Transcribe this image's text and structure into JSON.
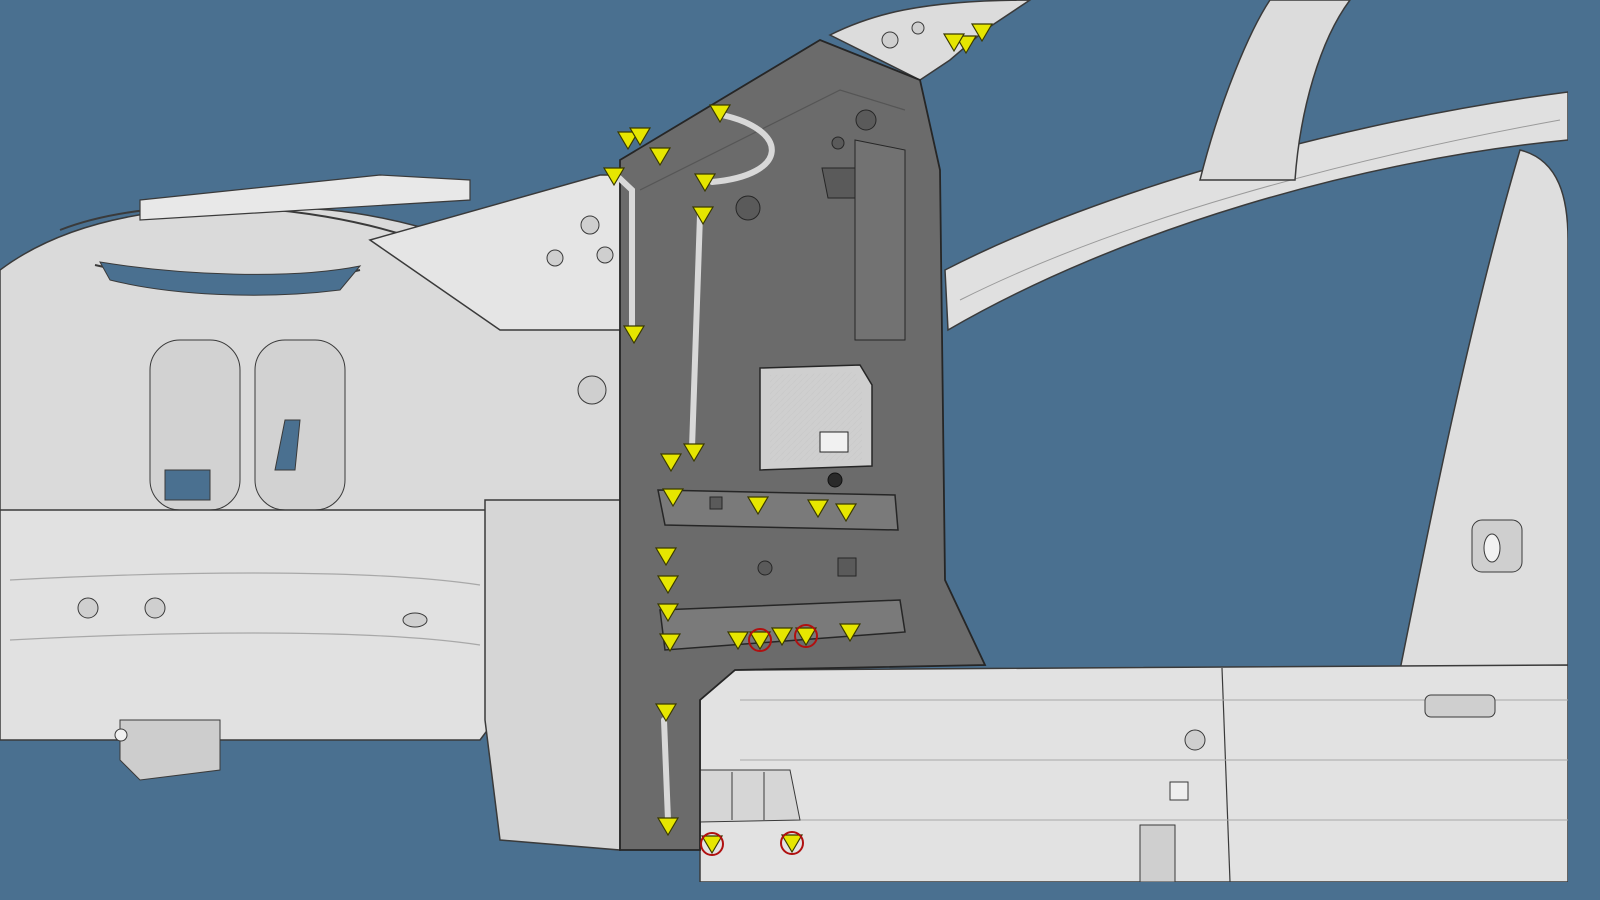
{
  "viewport": {
    "background": "#4a7090",
    "panel_light": "#e3e3e3",
    "panel_mid": "#cfcfcf",
    "panel_shadow": "#b8b8b8",
    "highlight_panel": "#6b6b6b",
    "highlight_panel_light": "#7d7d7d",
    "outline": "#3a3a3a",
    "marker_fill": "#e6e600",
    "marker_stroke": "#3a3a00",
    "ring_color": "#b01010"
  },
  "markers": {
    "weld_points": 30,
    "ringed_weld_points": 4
  }
}
